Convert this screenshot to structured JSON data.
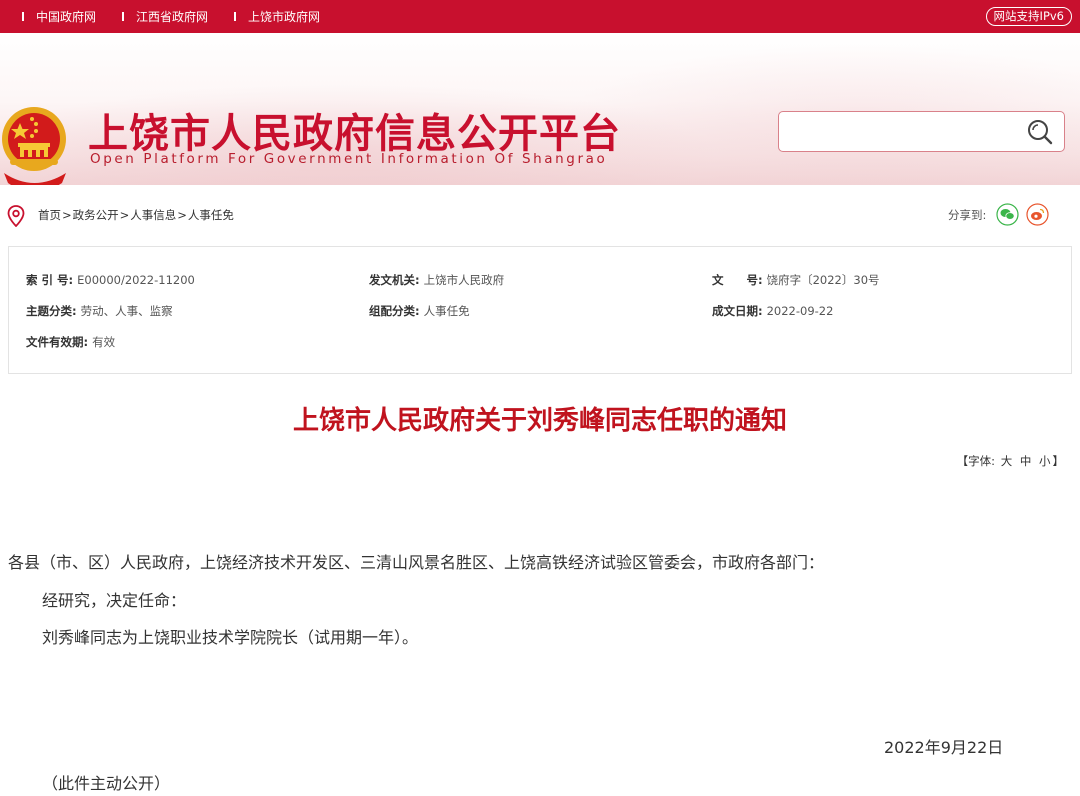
{
  "topbar": {
    "links": [
      "中国政府网",
      "江西省政府网",
      "上饶市政府网"
    ],
    "ipv6": "网站支持IPv6"
  },
  "header": {
    "title": "上饶市人民政府信息公开平台",
    "subtitle": "Open Platform For Government Information Of Shangrao",
    "search": {
      "value": "",
      "placeholder": ""
    }
  },
  "breadcrumb": [
    "首页",
    "政务公开",
    "人事信息",
    "人事任免"
  ],
  "share": {
    "label": "分享到:",
    "icons": [
      "wechat-icon",
      "weibo-icon"
    ]
  },
  "meta": {
    "index_no": {
      "label": "索 引 号:",
      "value": "E00000/2022-11200"
    },
    "issuer": {
      "label": "发文机关:",
      "value": "上饶市人民政府"
    },
    "doc_no": {
      "label": "文　　号:",
      "value": "饶府字〔2022〕30号"
    },
    "topic": {
      "label": "主题分类:",
      "value": "劳动、人事、监察"
    },
    "category": {
      "label": "组配分类:",
      "value": "人事任免"
    },
    "date": {
      "label": "成文日期:",
      "value": "2022-09-22"
    },
    "validity": {
      "label": "文件有效期:",
      "value": "有效"
    }
  },
  "doc": {
    "title": "上饶市人民政府关于刘秀峰同志任职的通知",
    "font_ctrl": {
      "prefix": "【字体:",
      "large": "大",
      "medium": "中",
      "small": "小",
      "suffix": "】"
    },
    "addressee": "各县（市、区）人民政府，上饶经济技术开发区、三清山风景名胜区、上饶高铁经济试验区管委会，市政府各部门：",
    "para1": "经研究，决定任命：",
    "para2": "刘秀峰同志为上饶职业技术学院院长（试用期一年）。",
    "sign_date": "2022年9月22日",
    "note": "（此件主动公开）"
  },
  "colors": {
    "brand_red": "#c8102e",
    "title_red": "#c0131e",
    "wechat_green": "#3bb54a",
    "weibo_orange": "#e8552d"
  }
}
